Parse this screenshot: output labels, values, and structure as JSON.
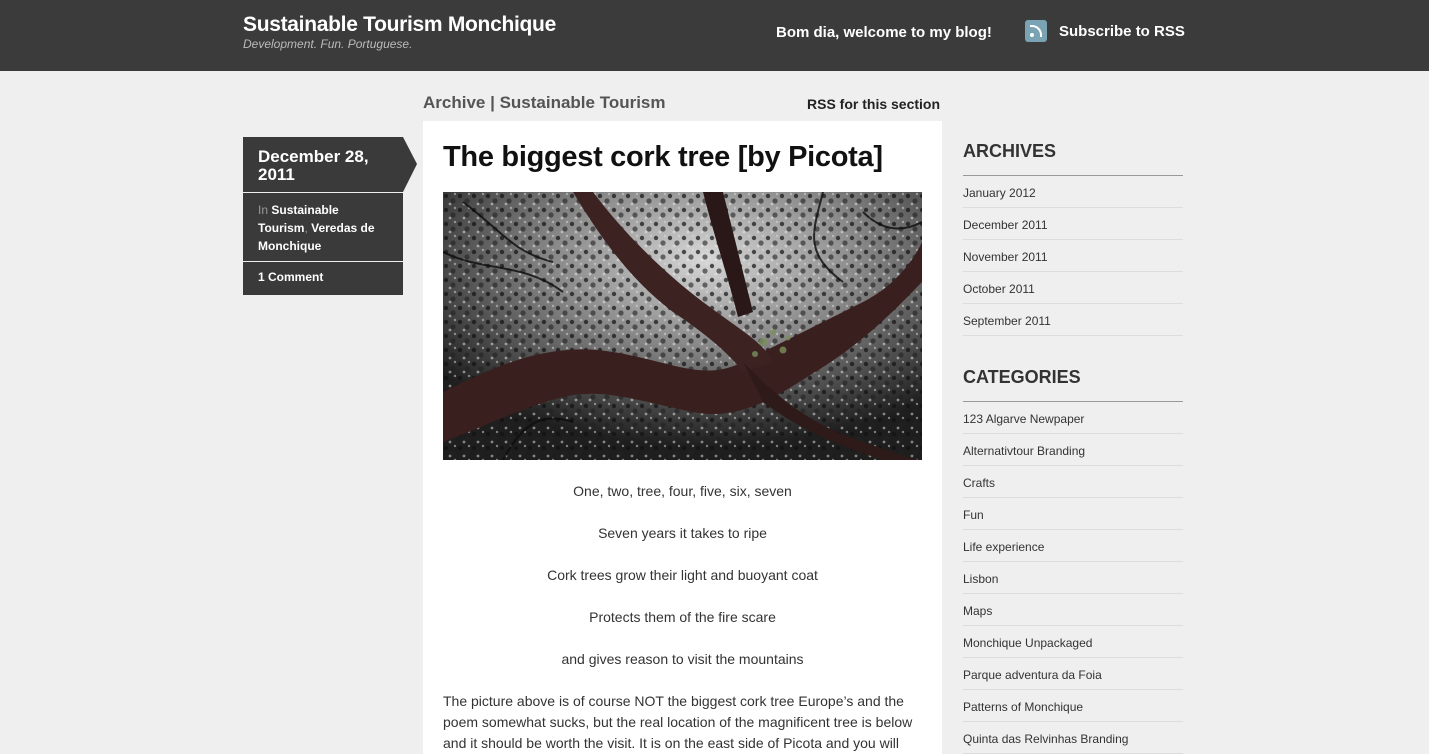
{
  "header": {
    "site_title": "Sustainable Tourism Monchique",
    "tagline": "Development. Fun. Portuguese.",
    "greeting": "Bom dia, welcome to my blog!",
    "rss_label": "Subscribe to RSS"
  },
  "archive": {
    "heading": "Archive | Sustainable Tourism",
    "rss_section": "RSS for this section"
  },
  "post": {
    "date": "December 28, 2011",
    "in_label": "In",
    "categories": [
      "Sustainable Tourism",
      "Veredas de Monchique"
    ],
    "comments": "1 Comment",
    "title": "The biggest cork tree [by Picota]",
    "poem": [
      "One, two, tree, four, five, six, seven",
      "Seven years it takes to ripe",
      "Cork trees grow their light and buoyant coat",
      "Protects them of the fire scare",
      "and gives reason to visit the mountains"
    ],
    "paragraph": "The picture above is of course NOT the biggest cork tree Europe’s and the poem somewhat sucks, but the real location of the magnificent tree is below and it should be worth the visit. It is on the east side of Picota and you will"
  },
  "sidebar": {
    "archives_title": "ARCHIVES",
    "archives": [
      "January 2012",
      "December 2011",
      "November 2011",
      "October 2011",
      "September 2011"
    ],
    "categories_title": "CATEGORIES",
    "categories": [
      "123 Algarve Newpaper",
      "Alternativtour Branding",
      "Crafts",
      "Fun",
      "Life experience",
      "Lisbon",
      "Maps",
      "Monchique Unpackaged",
      "Parque adventura da Foia",
      "Patterns of Monchique",
      "Quinta das Relvinhas Branding"
    ]
  },
  "colors": {
    "topbar": "#3b3b3b",
    "page_bg": "#efefef",
    "meta_box": "#3a3a3a",
    "rss_icon": "#7aa3b3"
  }
}
